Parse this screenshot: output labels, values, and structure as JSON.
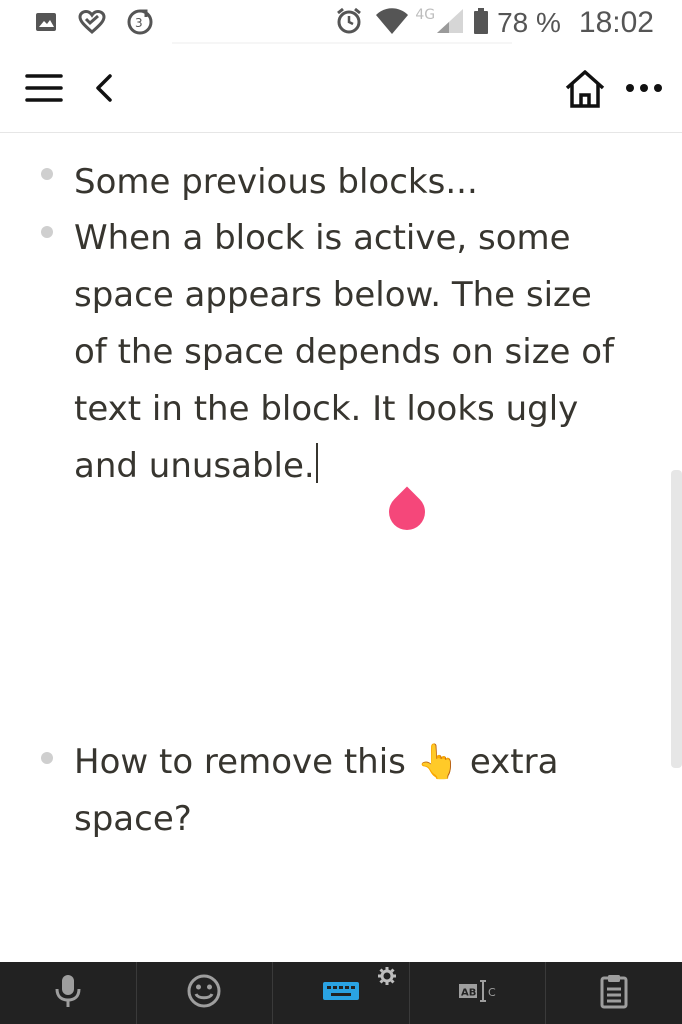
{
  "status_bar": {
    "network_type": "4G",
    "battery": "78 %",
    "time": "18:02",
    "icons": [
      "gallery-icon",
      "heart-chat-icon",
      "sync-icon",
      "alarm-icon",
      "wifi-icon",
      "signal-icon",
      "battery-icon"
    ]
  },
  "topbar": {
    "left_icons": [
      "menu-icon",
      "back-icon"
    ],
    "right_icons": [
      "home-icon",
      "more-icon"
    ]
  },
  "blocks": [
    {
      "text": "Some previous blocks..."
    },
    {
      "text": "When a block is active, some space appears below. The size of the space depends on size of text in the block. It looks ugly and unusable."
    },
    {
      "text": "How to remove this 👆 extra space?"
    }
  ],
  "keyboard_toolbar": {
    "items": [
      "microphone-icon",
      "emoji-icon",
      "keyboard-icon",
      "text-correction-icon",
      "clipboard-icon"
    ],
    "active_color": "#2aa3e3"
  },
  "colors": {
    "text": "#37352f",
    "selection_handle": "#f5477a",
    "toolbar_bg": "#222222"
  }
}
